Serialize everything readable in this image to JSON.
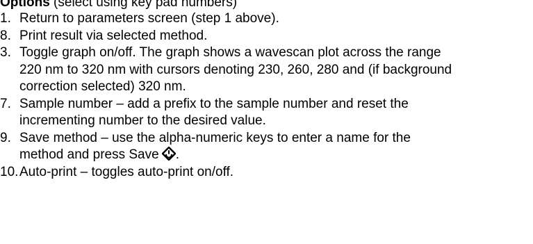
{
  "heading": {
    "bold": "Options",
    "rest": " (select using key pad numbers)"
  },
  "items": [
    {
      "num": "1.",
      "text": "Return to parameters screen (step 1 above)."
    },
    {
      "num": "8.",
      "text": "Print result via selected method."
    },
    {
      "num": "3.",
      "text": "Toggle graph on/off. The graph shows a wavescan plot across the range 220 nm to 320 nm with cursors denoting 230, 260, 280 and (if background correction selected) 320 nm."
    },
    {
      "num": "7.",
      "text": "Sample number – add a prefix to the sample number and reset the incrementing number to the desired value."
    },
    {
      "num": "9.",
      "text": "Save method – use the alpha-numeric keys to enter a name for the method and press Save",
      "suffix": "."
    },
    {
      "num": "10.",
      "text": "Auto-print – toggles auto-print on/off."
    }
  ],
  "icons": {
    "save": "save-diamond-icon"
  }
}
